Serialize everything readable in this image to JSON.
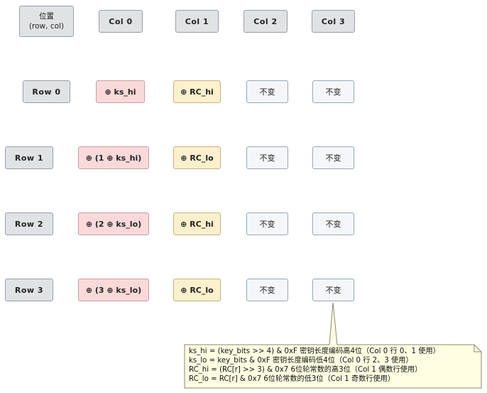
{
  "header": {
    "position_line1": "位置",
    "position_line2": "(row, col)",
    "cols": [
      "Col 0",
      "Col 1",
      "Col 2",
      "Col 3"
    ]
  },
  "rows": [
    {
      "label": "Row 0",
      "col0": "⊕ ks_hi",
      "col1": "⊕ RC_hi",
      "col2": "不变",
      "col3": "不变"
    },
    {
      "label": "Row 1",
      "col0": "⊕ (1 ⊕ ks_hi)",
      "col1": "⊕ RC_lo",
      "col2": "不变",
      "col3": "不变"
    },
    {
      "label": "Row 2",
      "col0": "⊕ (2 ⊕ ks_lo)",
      "col1": "⊕ RC_hi",
      "col2": "不变",
      "col3": "不变"
    },
    {
      "label": "Row 3",
      "col0": "⊕ (3 ⊕ ks_lo)",
      "col1": "⊕ RC_lo",
      "col2": "不变",
      "col3": "不变"
    }
  ],
  "note": {
    "lines": [
      "ks_hi = (key_bits >> 4) & 0xF 密钥长度编码高4位（Col 0 行 0、1 使用）",
      "ks_lo = key_bits & 0xF 密钥长度编码低4位（Col 0 行 2、3 使用）",
      "RC_hi = (RC[r] >> 3) & 0x7 6位轮常数的高3位（Col 1 偶数行使用）",
      "RC_lo = RC[r] & 0x7 6位轮常数的低3位（Col 1 奇数行使用）"
    ]
  },
  "colors": {
    "header_fill": "#e1e2e4",
    "ks_fill": "#fbd9d9",
    "rc_fill": "#fdf0cc",
    "unchanged_fill": "#f4f6f9",
    "note_fill": "#fefee2"
  }
}
